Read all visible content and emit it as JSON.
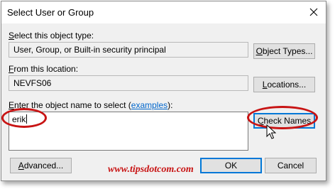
{
  "window": {
    "title": "Select User or Group",
    "close_glyph": "✕"
  },
  "object_type": {
    "label_prefix": "S",
    "label_rest": "elect this object type:",
    "value": "User, Group, or Built-in security principal",
    "button_prefix": "O",
    "button_rest": "bject Types..."
  },
  "location": {
    "label_prefix": "F",
    "label_rest": "rom this location:",
    "value": "NEVFS06",
    "button_prefix": "L",
    "button_rest": "ocations..."
  },
  "object_name": {
    "label_prefix": "E",
    "label_rest": "nter the object name to select (",
    "link": "examples",
    "label_suffix": "):",
    "value": "erik",
    "check_names_prefix": "C",
    "check_names_rest": "heck Names"
  },
  "footer": {
    "advanced_prefix": "A",
    "advanced_rest": "dvanced...",
    "ok": "OK",
    "cancel": "Cancel"
  },
  "watermark": "www.tipsdotcom.com",
  "annotation_color": "#c81414"
}
